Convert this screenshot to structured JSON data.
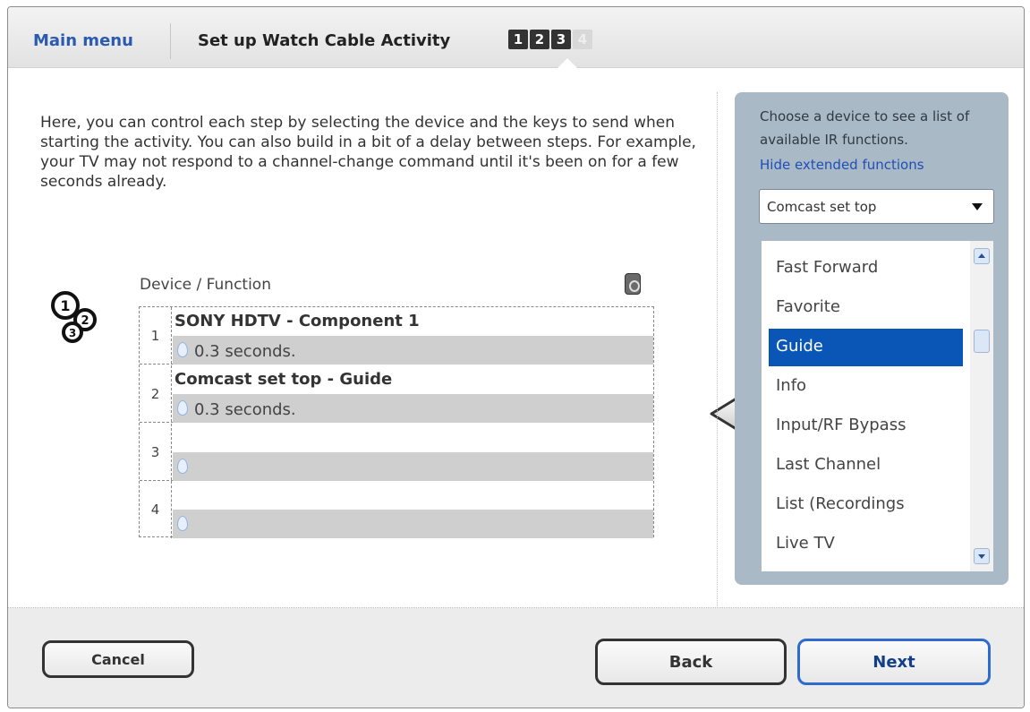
{
  "header": {
    "main_menu": "Main menu",
    "title": "Set up Watch Cable Activity",
    "steps": [
      "1",
      "2",
      "3",
      "4"
    ],
    "active_steps": 3
  },
  "intro_text": "Here, you can control each step by selecting the device and the keys to send when starting the activity. You can also build in a bit of a delay between steps. For example, your TV may not respond to a channel-change command until it's been on for a few seconds already.",
  "table": {
    "header_label": "Device / Function",
    "rows": [
      {
        "num": "1",
        "command": "SONY HDTV - Component 1",
        "delay": "0.3 seconds."
      },
      {
        "num": "2",
        "command": "Comcast set top - Guide",
        "delay": "0.3 seconds."
      },
      {
        "num": "3",
        "command": "",
        "delay": ""
      },
      {
        "num": "4",
        "command": "",
        "delay": ""
      }
    ]
  },
  "panel": {
    "hint": "Choose a device to see a list of available IR functions.",
    "hide_link": "Hide extended functions",
    "selected_device": "Comcast set top",
    "functions": [
      "Fast Forward",
      "Favorite",
      "Guide",
      "Info",
      "Input/RF Bypass",
      "Last Channel",
      "List (Recordings",
      "Live TV"
    ],
    "selected_function": "Guide"
  },
  "footer": {
    "cancel": "Cancel",
    "back": "Back",
    "next": "Next"
  },
  "colors": {
    "link_blue": "#2a5bb0",
    "selection_blue": "#0a56b7",
    "panel_bg": "#a9b9c6",
    "next_border": "#2e6ad0"
  }
}
